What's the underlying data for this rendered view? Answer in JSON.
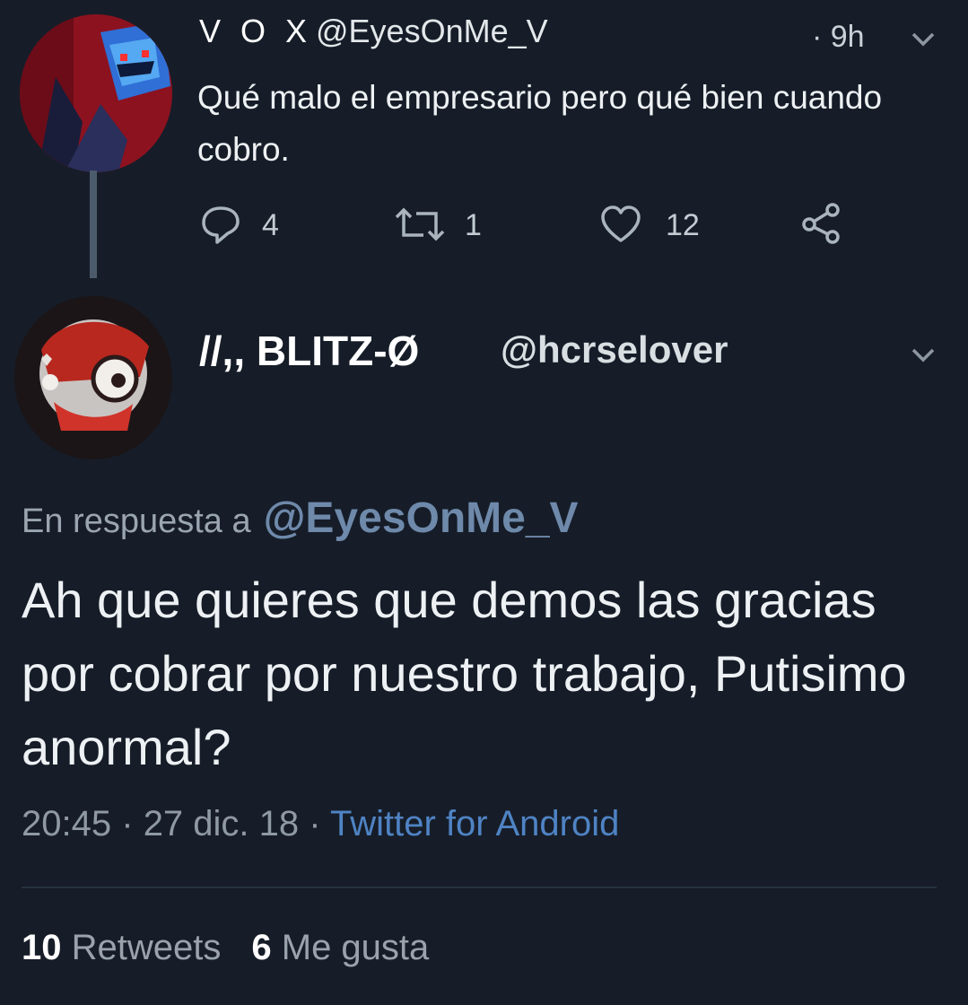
{
  "tweet1": {
    "display_name": "V O X",
    "handle": "@EyesOnMe_V",
    "time": "· 9h",
    "text": "Qué malo el empresario pero qué bien cuando cobro.",
    "replies": "4",
    "retweets": "1",
    "likes": "12"
  },
  "tweet2": {
    "display_name": "//,, BLITZ-Ø",
    "handle": "@hcrselover",
    "reply_prefix": "En respuesta a",
    "reply_mention": "@EyesOnMe_V",
    "text": "Ah que quieres que demos las gracias por cobrar por nuestro trabajo, Putisimo anormal?",
    "time": "20:45",
    "date": "27 dic. 18",
    "source": "Twitter for Android",
    "retweet_count": "10",
    "retweet_label": "Retweets",
    "like_count": "6",
    "like_label": "Me gusta"
  },
  "colors": {
    "background": "#161d28",
    "link": "#4f83c4",
    "mention": "#6e89aa",
    "muted": "#8f99a3"
  },
  "icons": {
    "reply": "reply-icon",
    "retweet": "retweet-icon",
    "like": "heart-icon",
    "share": "share-icon",
    "caret": "chevron-down-icon"
  }
}
